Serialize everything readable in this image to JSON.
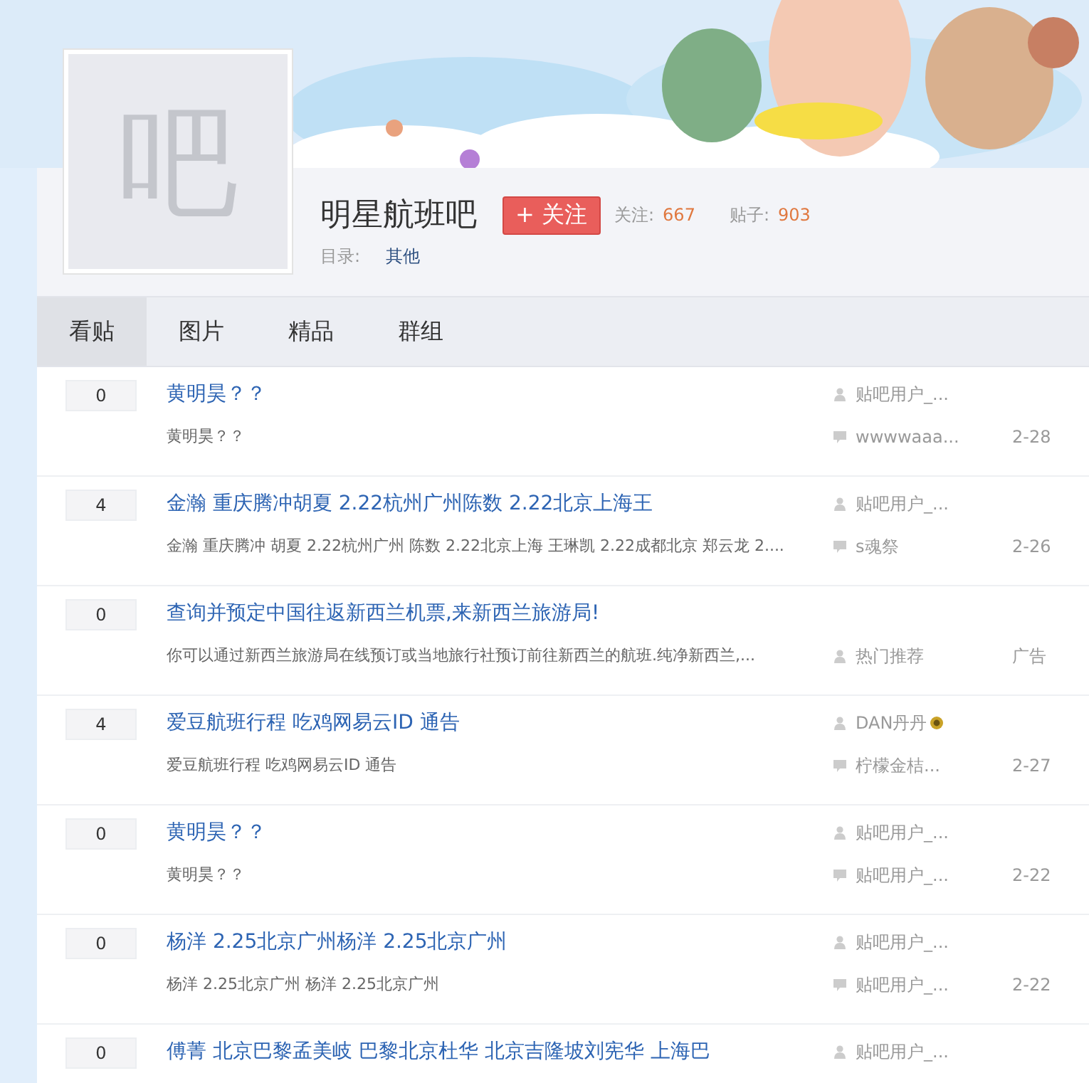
{
  "forum": {
    "logo_char": "吧",
    "name": "明星航班吧",
    "follow_button": "+ 关注",
    "stats": [
      {
        "label": "关注:",
        "value": "667"
      },
      {
        "label": "贴子:",
        "value": "903"
      }
    ],
    "category_label": "目录:",
    "category": "其他"
  },
  "tabs": [
    {
      "label": "看贴",
      "selected": true
    },
    {
      "label": "图片",
      "selected": false
    },
    {
      "label": "精品",
      "selected": false
    },
    {
      "label": "群组",
      "selected": false
    }
  ],
  "threads": [
    {
      "kind": "post",
      "replies": "0",
      "title": "黄明昊？？",
      "excerpt": "黄明昊？？",
      "author": "贴吧用户_...",
      "author_badge": false,
      "last_reply": "wwwwaaa...",
      "date": "2-28"
    },
    {
      "kind": "post",
      "replies": "4",
      "title": "金瀚 重庆腾冲胡夏 2.22杭州广州陈数 2.22北京上海王",
      "excerpt": "金瀚 重庆腾冲 胡夏 2.22杭州广州 陈数 2.22北京上海 王琳凯 2.22成都北京 郑云龙 2....",
      "author": "贴吧用户_...",
      "author_badge": false,
      "last_reply": "s魂祭",
      "date": "2-26"
    },
    {
      "kind": "ad",
      "replies": "0",
      "title": "查询并预定中国往返新西兰机票,来新西兰旅游局!",
      "excerpt": "你可以通过新西兰旅游局在线预订或当地旅行社预订前往新西兰的航班.纯净新西兰,...",
      "last_reply": "热门推荐",
      "date": "广告"
    },
    {
      "kind": "post",
      "replies": "4",
      "title": "爱豆航班行程 吃鸡网易云ID 通告",
      "excerpt": "爱豆航班行程 吃鸡网易云ID 通告",
      "author": "DAN丹丹",
      "author_badge": true,
      "last_reply": "柠檬金桔...",
      "date": "2-27"
    },
    {
      "kind": "post",
      "replies": "0",
      "title": "黄明昊？？",
      "excerpt": "黄明昊？？",
      "author": "贴吧用户_...",
      "author_badge": false,
      "last_reply": "贴吧用户_...",
      "date": "2-22"
    },
    {
      "kind": "post",
      "replies": "0",
      "title": "杨洋 2.25北京广州杨洋 2.25北京广州",
      "excerpt": "杨洋 2.25北京广州 杨洋 2.25北京广州",
      "author": "贴吧用户_...",
      "author_badge": false,
      "last_reply": "贴吧用户_...",
      "date": "2-22"
    },
    {
      "replies": "0",
      "title": "傅菁 北京巴黎孟美岐 巴黎北京杜华 北京吉隆坡刘宪华 上海巴",
      "author": "贴吧用户_...",
      "author_badge": false
    }
  ]
}
